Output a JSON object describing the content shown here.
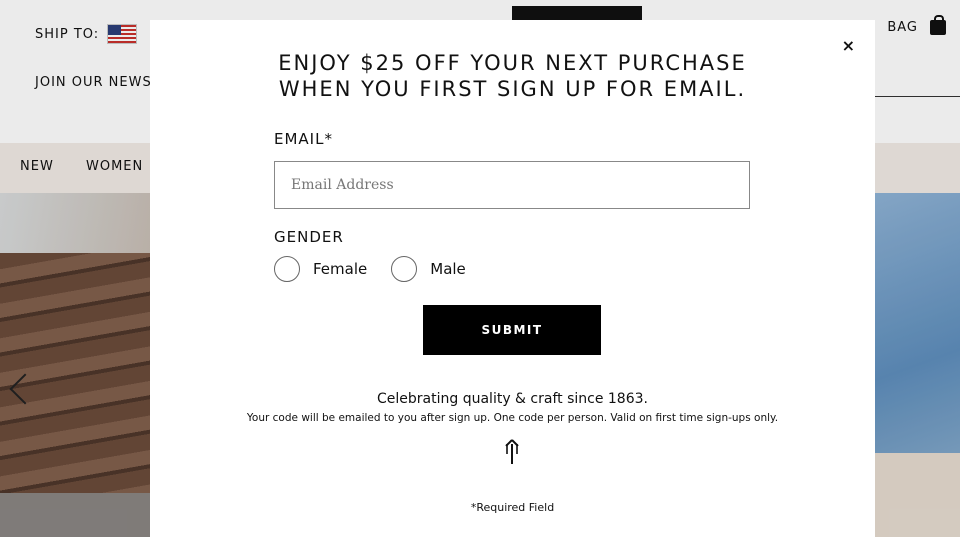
{
  "header": {
    "ship_to_label": "SHIP TO:",
    "flag_icon": "us-flag-icon",
    "join_text": "JOIN OUR NEWS",
    "bag_label": "BAG",
    "bag_icon": "shopping-bag-icon"
  },
  "nav": {
    "items": [
      "NEW",
      "WOMEN"
    ]
  },
  "modal": {
    "close_label": "×",
    "headline_line1": "ENJOY $25 OFF YOUR NEXT PURCHASE",
    "headline_line2": "WHEN YOU FIRST SIGN UP FOR EMAIL.",
    "email_label": "EMAIL*",
    "email_placeholder": "Email Address",
    "email_value": "",
    "gender_label": "GENDER",
    "gender_options": [
      "Female",
      "Male"
    ],
    "submit_label": "SUBMIT",
    "tagline": "Celebrating quality & craft since 1863.",
    "fineprint": "Your code will be emailed to you after sign up. One code per person. Valid on first time sign-ups only.",
    "brand_icon": "frye-arrow-logo-icon",
    "required_note": "*Required Field"
  },
  "colors": {
    "nav_bg": "#f1ebe5",
    "button_bg": "#000000",
    "text": "#111111"
  }
}
